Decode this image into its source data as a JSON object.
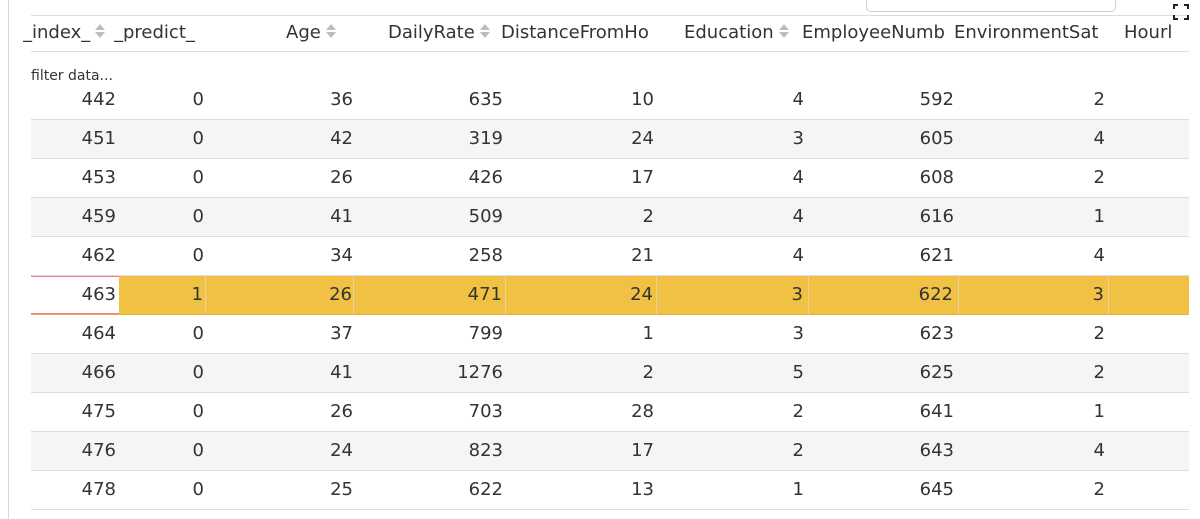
{
  "table": {
    "filter_placeholder": "filter data...",
    "columns": [
      "_index_",
      "_predict_",
      "Age",
      "DailyRate",
      "DistanceFromHome",
      "Education",
      "EmployeeNumber",
      "EnvironmentSatisfaction",
      "HourlyRate"
    ],
    "column_labels_visible": [
      "_index_",
      "_predict_",
      "Age",
      "DailyRate",
      "DistanceFromHo",
      "Education",
      "EmployeeNumb",
      "EnvironmentSat",
      "Hourl"
    ],
    "sortable": [
      true,
      false,
      true,
      true,
      false,
      true,
      false,
      false,
      false
    ],
    "selected_row_index": 5,
    "rows": [
      [
        "442",
        "0",
        "36",
        "635",
        "10",
        "4",
        "592",
        "2"
      ],
      [
        "451",
        "0",
        "42",
        "319",
        "24",
        "3",
        "605",
        "4"
      ],
      [
        "453",
        "0",
        "26",
        "426",
        "17",
        "4",
        "608",
        "2"
      ],
      [
        "459",
        "0",
        "41",
        "509",
        "2",
        "4",
        "616",
        "1"
      ],
      [
        "462",
        "0",
        "34",
        "258",
        "21",
        "4",
        "621",
        "4"
      ],
      [
        "463",
        "1",
        "26",
        "471",
        "24",
        "3",
        "622",
        "3"
      ],
      [
        "464",
        "0",
        "37",
        "799",
        "1",
        "3",
        "623",
        "2"
      ],
      [
        "466",
        "0",
        "41",
        "1276",
        "2",
        "5",
        "625",
        "2"
      ],
      [
        "475",
        "0",
        "26",
        "703",
        "28",
        "2",
        "641",
        "1"
      ],
      [
        "476",
        "0",
        "24",
        "823",
        "17",
        "2",
        "643",
        "4"
      ],
      [
        "478",
        "0",
        "25",
        "622",
        "13",
        "1",
        "645",
        "2"
      ]
    ]
  },
  "colors": {
    "selected_row": "#f0c142",
    "selected_index_border": "#ff6fa5",
    "alt_row": "#f5f5f5",
    "grid_line": "#dddddd"
  },
  "icons": {
    "expand": "expand-icon",
    "sort": "sort-icon"
  }
}
